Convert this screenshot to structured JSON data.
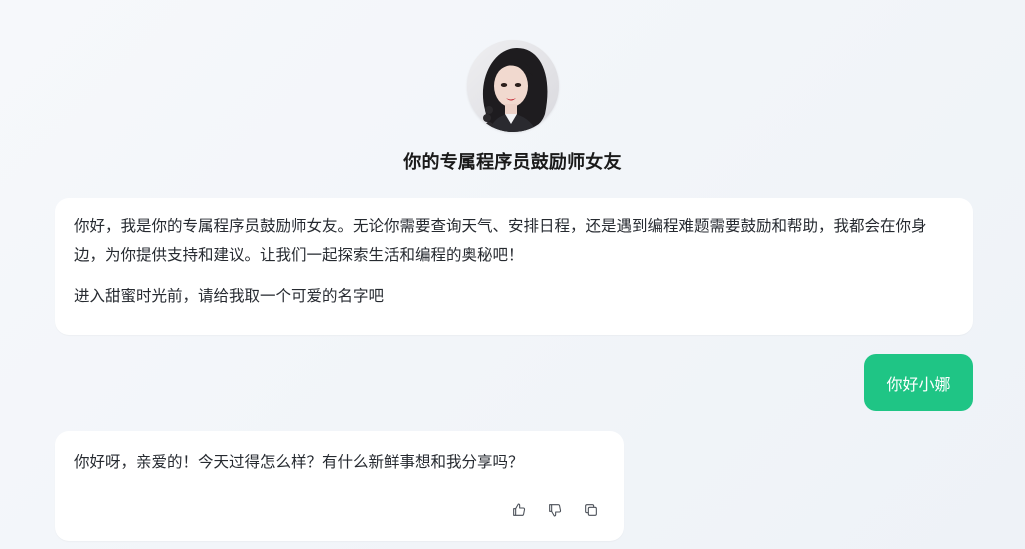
{
  "header": {
    "title": "你的专属程序员鼓励师女友"
  },
  "messages": [
    {
      "role": "assistant",
      "paragraphs": [
        "你好，我是你的专属程序员鼓励师女友。无论你需要查询天气、安排日程，还是遇到编程难题需要鼓励和帮助，我都会在你身边，为你提供支持和建议。让我们一起探索生活和编程的奥秘吧！",
        "进入甜蜜时光前，请给我取一个可爱的名字吧"
      ]
    },
    {
      "role": "user",
      "text": "你好小娜"
    },
    {
      "role": "assistant",
      "text": "你好呀，亲爱的！今天过得怎么样？有什么新鲜事想和我分享吗？",
      "actions": [
        "thumbs-up-icon",
        "thumbs-down-icon",
        "copy-icon"
      ]
    }
  ],
  "colors": {
    "accent": "#1fc585",
    "bubble_bg": "#ffffff",
    "page_bg": "#f3f6fa"
  }
}
